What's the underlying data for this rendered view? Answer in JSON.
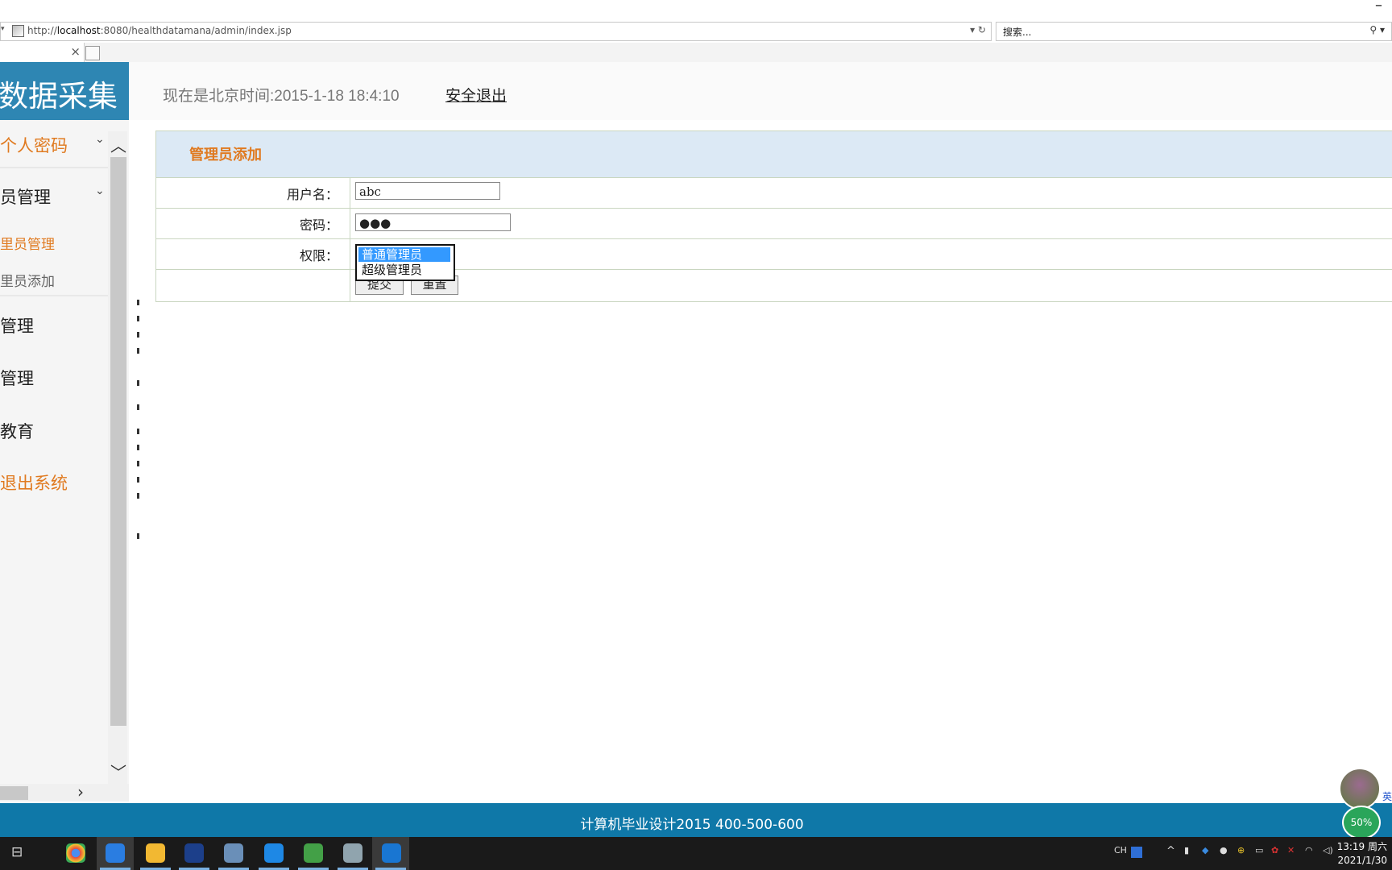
{
  "browser": {
    "url_prefix": "http://",
    "url_host": "localhost",
    "url_rest": ":8080/healthdatamana/admin/index.jsp",
    "search_placeholder": "搜索..."
  },
  "header": {
    "brand": "数据采集",
    "time_text": "现在是北京时间:2015-1-18 18:4:10",
    "logout": "安全退出"
  },
  "sidebar": {
    "items": [
      {
        "label": "个人密码",
        "color": "#e07a20"
      },
      {
        "label": "员管理",
        "color": "#222222"
      },
      {
        "label": "里员管理",
        "color": "#e07a20"
      },
      {
        "label": "里员添加",
        "color": "#666666"
      },
      {
        "label": "管理",
        "color": "#222222"
      },
      {
        "label": "管理",
        "color": "#222222"
      },
      {
        "label": "教育",
        "color": "#222222"
      },
      {
        "label": "退出系统",
        "color": "#e07a20"
      }
    ]
  },
  "form": {
    "title": "管理员添加",
    "username_label": "用户名：",
    "username_value": "abc",
    "password_label": "密码：",
    "password_value": "●●●",
    "permission_label": "权限：",
    "permission_options": [
      "普通管理员",
      "超级管理员"
    ],
    "submit": "提交",
    "reset": "重置"
  },
  "footer": {
    "text": "计算机毕业设计2015  400-500-600"
  },
  "floating": {
    "percent": "50%",
    "side": "英"
  },
  "taskbar": {
    "ime": "CH",
    "time": "13:19 周六",
    "date": "2021/1/30"
  }
}
